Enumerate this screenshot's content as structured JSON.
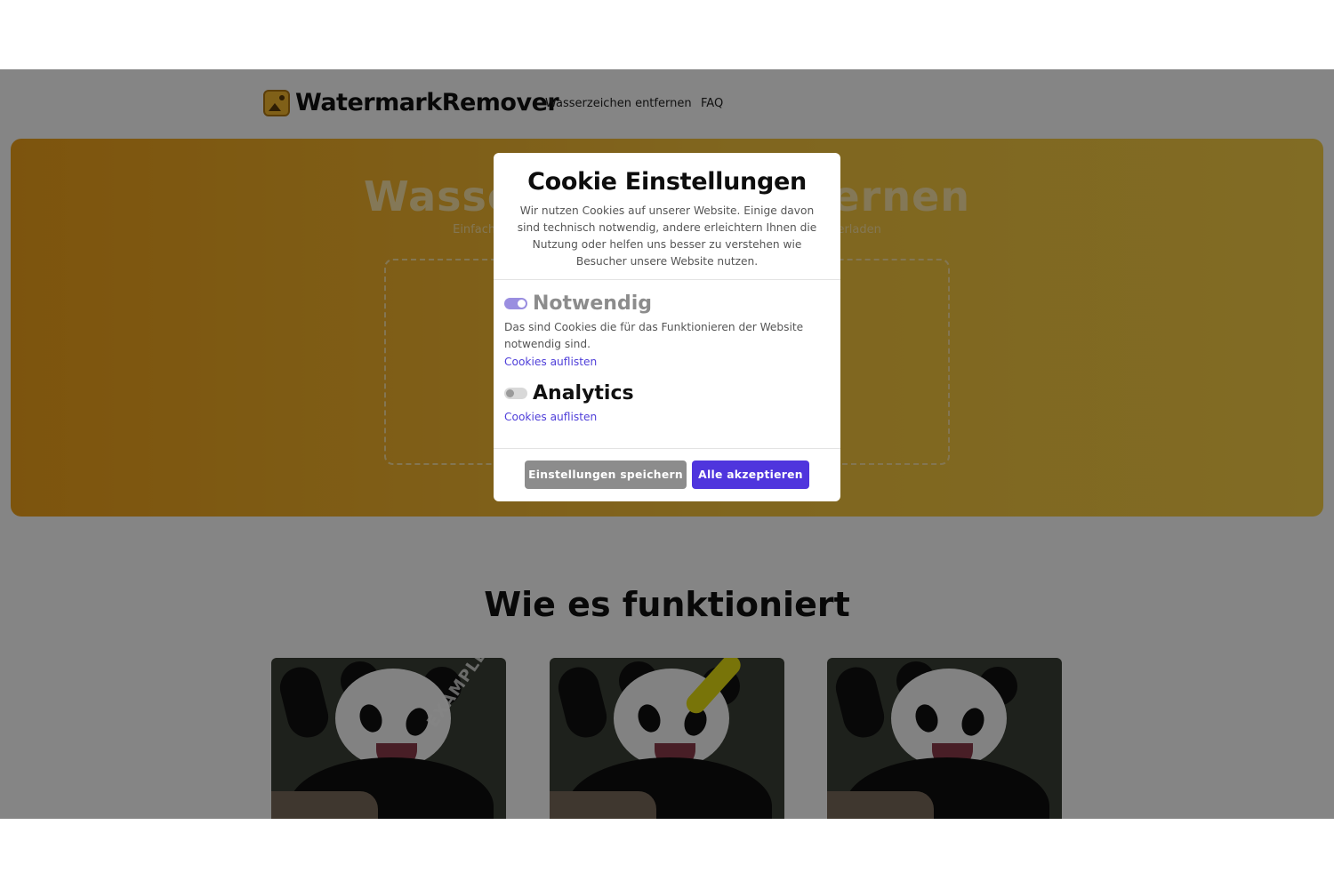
{
  "header": {
    "logo_text": "WatermarkRemover",
    "nav": [
      {
        "label": "Wasserzeichen entfernen"
      },
      {
        "label": "FAQ"
      }
    ]
  },
  "hero": {
    "title": "Wasserzeichen entfernen",
    "subtitle": "Einfach Foto hochladen, Wasserzeichen markieren und Bild herunterladen"
  },
  "how_it_works": {
    "title": "Wie es funktioniert",
    "examples": [
      {
        "watermark_text": "EXAMPLE"
      },
      {},
      {}
    ]
  },
  "cookie_modal": {
    "title": "Cookie Einstellungen",
    "description": "Wir nutzen Cookies auf unserer Website. Einige davon sind technisch notwendig, andere erleichtern Ihnen die Nutzung oder helfen uns besser zu verstehen wie Besucher unsere Website nutzen.",
    "categories": [
      {
        "name": "Notwendig",
        "enabled": true,
        "description": "Das sind Cookies die für das Funktionieren der Website notwendig sind.",
        "link": "Cookies auflisten"
      },
      {
        "name": "Analytics",
        "enabled": false,
        "link": "Cookies auflisten"
      }
    ],
    "buttons": {
      "save": "Einstellungen speichern",
      "accept_all": "Alle akzeptieren"
    }
  },
  "colors": {
    "accent": "#4f35dd",
    "link": "#4f3fd9",
    "hero_gradient_start": "#f0a21a",
    "hero_gradient_end": "#f7cf46"
  }
}
